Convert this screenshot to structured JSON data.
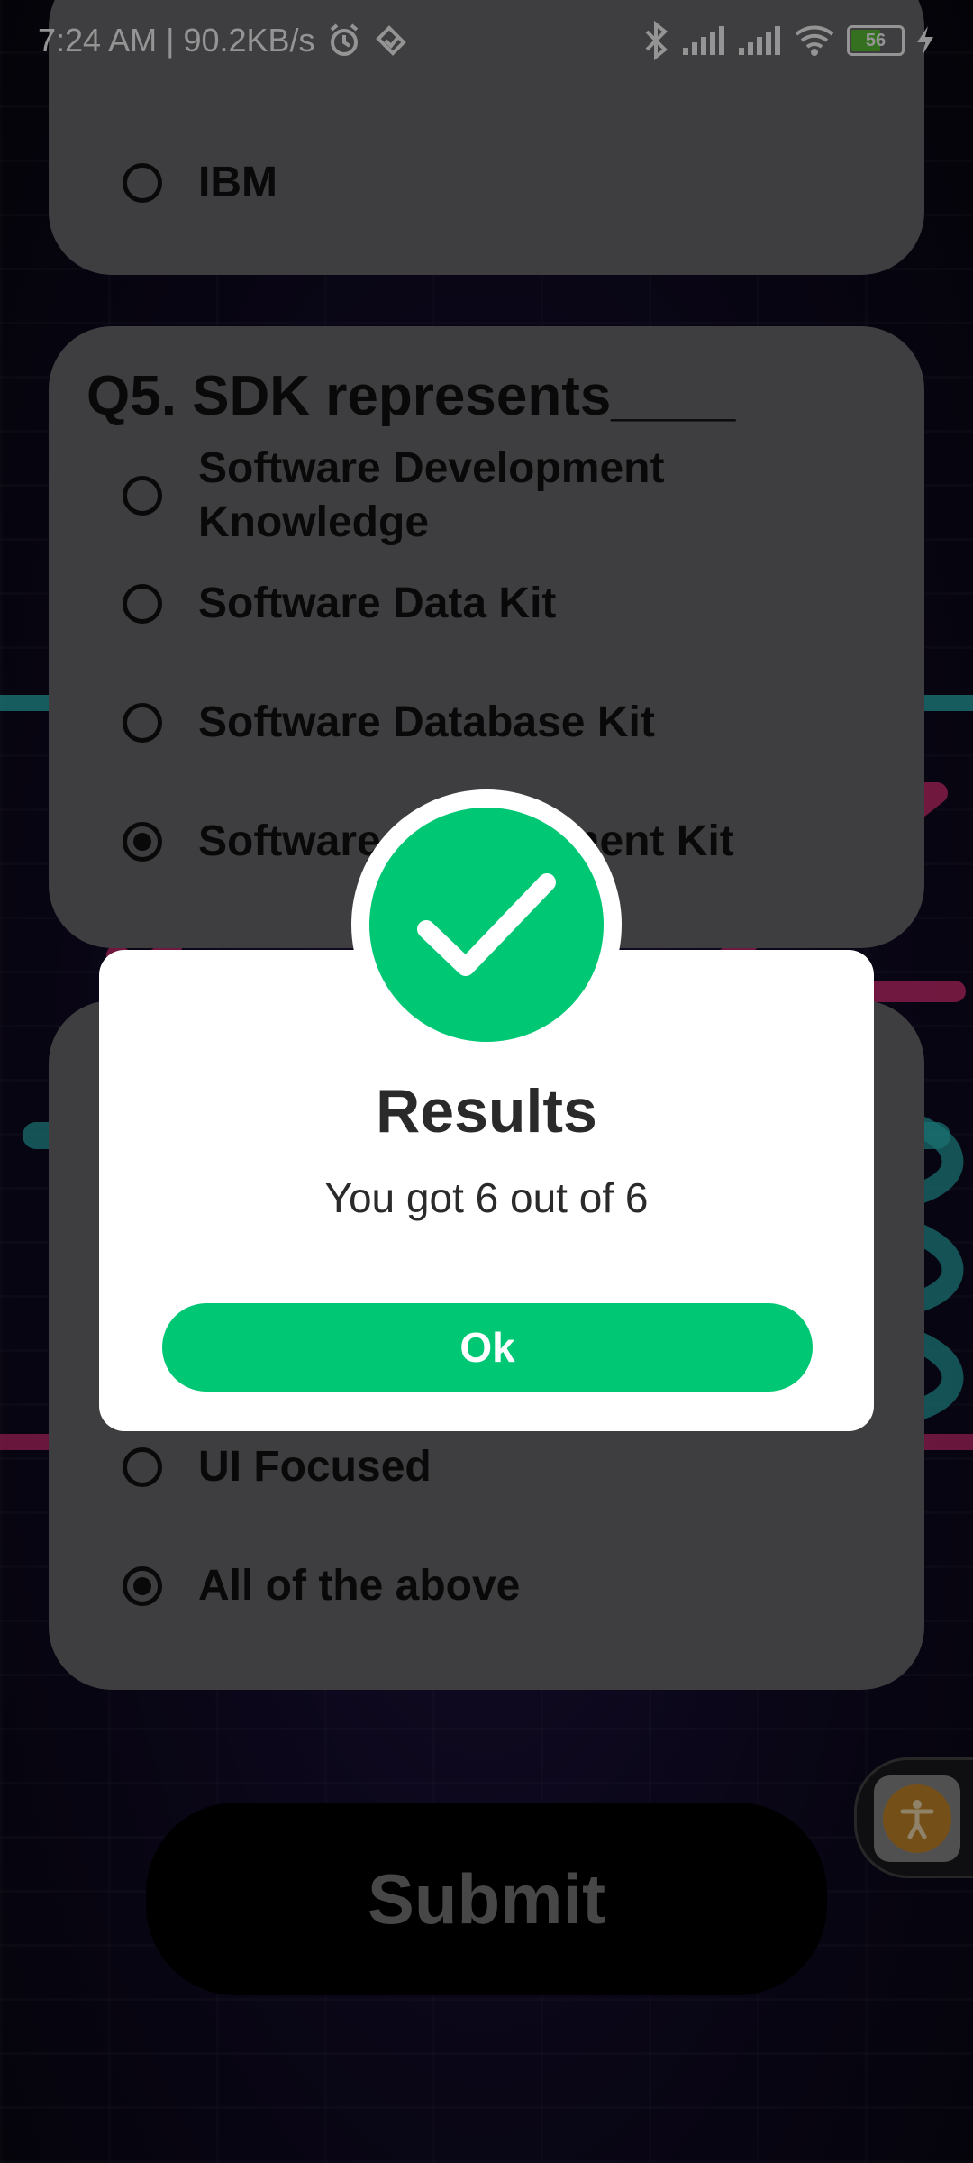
{
  "status_bar": {
    "time_speed": "7:24 AM | 90.2KB/s",
    "battery": "56"
  },
  "quiz": {
    "prev_question": {
      "options": [
        {
          "label": "IBM",
          "selected": false
        }
      ]
    },
    "q5": {
      "title": "Q5. SDK represents____",
      "options": [
        {
          "label": "Software Development Knowledge",
          "selected": false
        },
        {
          "label": "Software Data Kit",
          "selected": false
        },
        {
          "label": "Software Database Kit",
          "selected": false
        },
        {
          "label": "Software Development Kit",
          "selected": true
        }
      ]
    },
    "q6": {
      "options": [
        {
          "label": "UI Focused",
          "selected": false
        },
        {
          "label": "All of the above",
          "selected": true
        }
      ]
    },
    "submit_label": "Submit"
  },
  "dialog": {
    "title": "Results",
    "message": "You got 6 out of 6",
    "ok_label": "Ok",
    "icon": "check-circle-icon"
  },
  "colors": {
    "accent": "#00C774",
    "card": "#6C6C6E",
    "submit_bg": "#000000"
  }
}
